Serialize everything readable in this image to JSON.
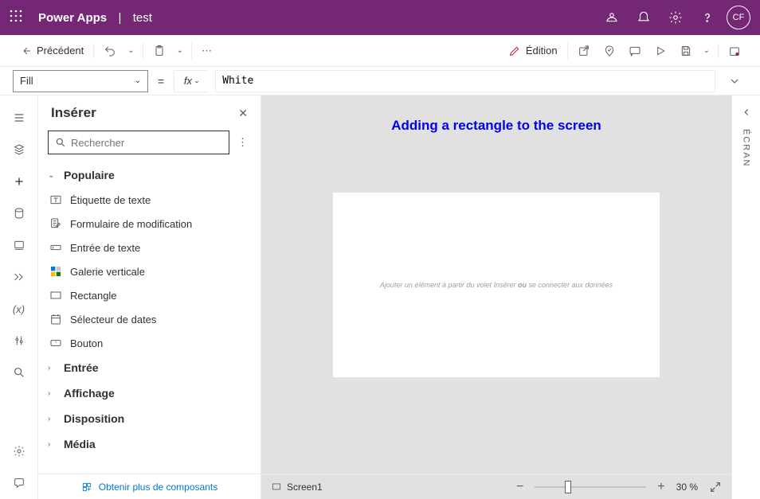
{
  "header": {
    "app_name": "Power Apps",
    "separator": "|",
    "doc_name": "test",
    "avatar_initials": "CF"
  },
  "commandbar": {
    "back_label": "Précédent",
    "edit_label": "Édition"
  },
  "formula": {
    "property": "Fill",
    "fx_label": "fx",
    "value": "White"
  },
  "insert_panel": {
    "title": "Insérer",
    "search_placeholder": "Rechercher",
    "groups": {
      "popular": "Populaire",
      "entry": "Entrée",
      "display": "Affichage",
      "layout": "Disposition",
      "media": "Média"
    },
    "controls": {
      "text_label": "Étiquette de texte",
      "edit_form": "Formulaire de modification",
      "text_input": "Entrée de texte",
      "vertical_gallery": "Galerie verticale",
      "rectangle": "Rectangle",
      "date_picker": "Sélecteur de dates",
      "button": "Bouton"
    },
    "footer_label": "Obtenir plus de composants"
  },
  "canvas": {
    "callout": "Adding a rectangle to the screen",
    "hint_prefix": "Ajouter un élément à partir du volet Insérer ",
    "hint_bold": "ou",
    "hint_suffix": " se connecter aux données"
  },
  "right_rail": {
    "label": "ÉCRAN"
  },
  "status": {
    "screen_name": "Screen1",
    "zoom_label": "30  %"
  }
}
